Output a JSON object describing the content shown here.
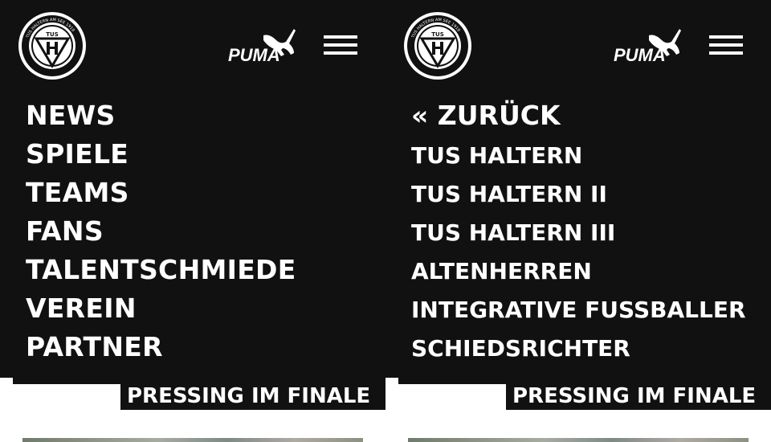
{
  "colors": {
    "menu_background": "#111111",
    "menu_text": "#ffffff",
    "page_background": "#ffffff"
  },
  "brand": {
    "club_logo_icon": "tus-haltern-crest-icon",
    "club_logo_text": "TUS HALTERN AM SEE 1919",
    "sponsor_logo_icon": "puma-logo-icon",
    "sponsor_logo_text": "PUMA"
  },
  "left_panel": {
    "menu_items": [
      {
        "label": "NEWS"
      },
      {
        "label": "SPIELE"
      },
      {
        "label": "TEAMS"
      },
      {
        "label": "FANS"
      },
      {
        "label": "TALENTSCHMIEDE"
      },
      {
        "label": "VEREIN"
      },
      {
        "label": "PARTNER"
      }
    ],
    "headline": "PRESSING IM FINALE"
  },
  "right_panel": {
    "back_label": "« ZURÜCK",
    "submenu_items": [
      {
        "label": "TUS HALTERN"
      },
      {
        "label": "TUS HALTERN II"
      },
      {
        "label": "TUS HALTERN III"
      },
      {
        "label": "ALTENHERREN"
      },
      {
        "label": "INTEGRATIVE FUSSBALLER"
      },
      {
        "label": "SCHIEDSRICHTER"
      }
    ],
    "headline": "PRESSING IM FINALE"
  }
}
